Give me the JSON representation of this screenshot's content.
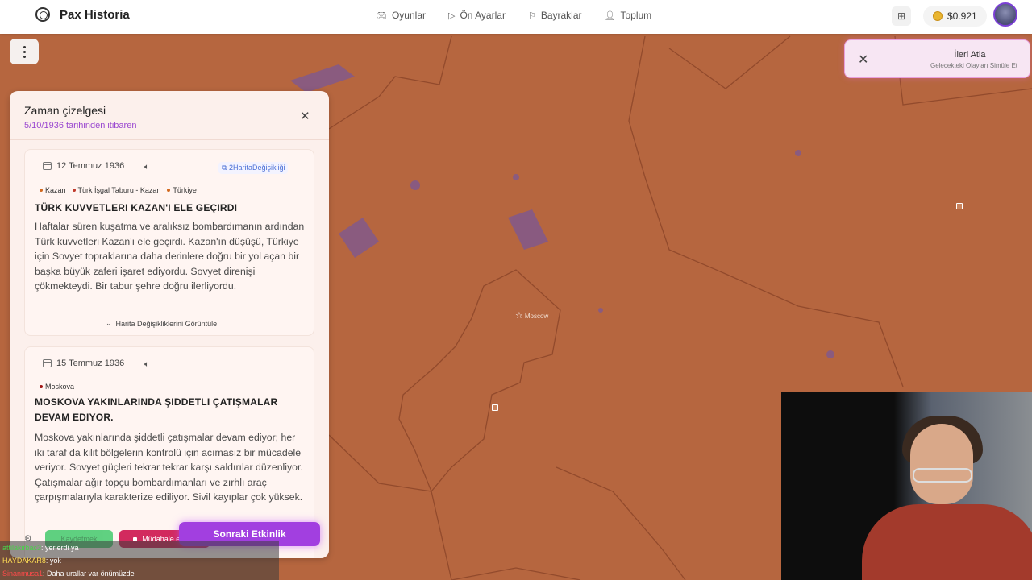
{
  "app": {
    "name": "Pax Historia"
  },
  "nav": {
    "items": [
      {
        "label": "Oyunlar",
        "icon": "gamepad-icon"
      },
      {
        "label": "Ön Ayarlar",
        "icon": "play-icon"
      },
      {
        "label": "Bayraklar",
        "icon": "flag-icon"
      },
      {
        "label": "Toplum",
        "icon": "users-icon"
      }
    ]
  },
  "wallet": {
    "balance": "$0.921"
  },
  "skip": {
    "title": "İleri Atla",
    "subtitle": "Gelecekteki Olayları Simüle Et"
  },
  "map": {
    "cities": [
      {
        "label": "Moscow"
      }
    ]
  },
  "timeline": {
    "title": "Zaman çizelgesi",
    "subtitle": "5/10/1936 tarihinden itibaren",
    "events": [
      {
        "date": "12 Temmuz 1936",
        "map_changes": "2HaritaDeğişikliği",
        "tags": [
          "Kazan",
          "Türk İşgal Taburu - Kazan",
          "Türkiye"
        ],
        "title": "TÜRK KUVVETLERI KAZAN'I ELE GEÇIRDI",
        "body": "Haftalar süren kuşatma ve aralıksız bombardımanın ardından Türk kuvvetleri Kazan'ı ele geçirdi. Kazan'ın düşüşü, Türkiye için Sovyet topraklarına daha derinlere doğru bir yol açan bir başka büyük zaferi işaret ediyordu. Sovyet direnişi çökmekteydi. Bir tabur şehre doğru ilerliyordu.",
        "view_changes": "Harita Değişikliklerini Görüntüle"
      },
      {
        "date": "15 Temmuz 1936",
        "tags": [
          "Moskova"
        ],
        "title": "MOSKOVA YAKINLARINDA ŞIDDETLI ÇATIŞMALAR DEVAM EDIYOR.",
        "body": "Moskova yakınlarında şiddetli çatışmalar devam ediyor; her iki taraf da kilit bölgelerin kontrolü için acımasız bir mücadele veriyor. Sovyet güçleri tekrar tekrar karşı saldırılar düzenliyor. Çatışmalar ağır topçu bombardımanları ve zırhlı araç çarpışmalarıyla karakterize ediliyor. Sivil kayıplar çok yüksek."
      }
    ]
  },
  "controls": {
    "save": "Kaydetmek",
    "intervene": "Müdahale etmek",
    "next": "Sonraki Etkinlik"
  },
  "chat": [
    {
      "user": "attilakirbac3",
      "msg": ": yerlerdi ya"
    },
    {
      "user": "HAYDAKAR8",
      "msg": ": yok"
    },
    {
      "user": "Sinanmusa1",
      "msg": ": Daha urallar var önümüzde"
    }
  ]
}
